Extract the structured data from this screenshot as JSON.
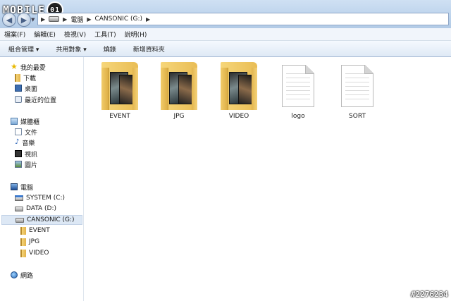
{
  "watermark": {
    "brand": "MOBILE",
    "badge": "01"
  },
  "address": {
    "crumbs": [
      "電腦",
      "CANSONIC (G:)"
    ]
  },
  "menu": [
    "檔案(F)",
    "編輯(E)",
    "檢視(V)",
    "工具(T)",
    "說明(H)"
  ],
  "toolbar": {
    "organize": "組合管理 ▾",
    "share": "共用對象 ▾",
    "burn": "燒錄",
    "new_folder": "新增資料夾"
  },
  "nav": {
    "favorites": "我的最愛",
    "downloads": "下載",
    "desktop": "桌面",
    "recent": "最近的位置",
    "libraries": "媒體櫃",
    "documents": "文件",
    "music": "音樂",
    "videos": "視訊",
    "pictures": "圖片",
    "computer": "電腦",
    "system": "SYSTEM (C:)",
    "data": "DATA (D:)",
    "cansonic": "CANSONIC (G:)",
    "sub_event": "EVENT",
    "sub_jpg": "JPG",
    "sub_video": "VIDEO",
    "network": "網路"
  },
  "files": [
    {
      "name": "EVENT",
      "type": "folder"
    },
    {
      "name": "JPG",
      "type": "folder"
    },
    {
      "name": "VIDEO",
      "type": "folder"
    },
    {
      "name": "logo",
      "type": "file"
    },
    {
      "name": "SORT",
      "type": "file"
    }
  ],
  "photo_id": "#2276234"
}
